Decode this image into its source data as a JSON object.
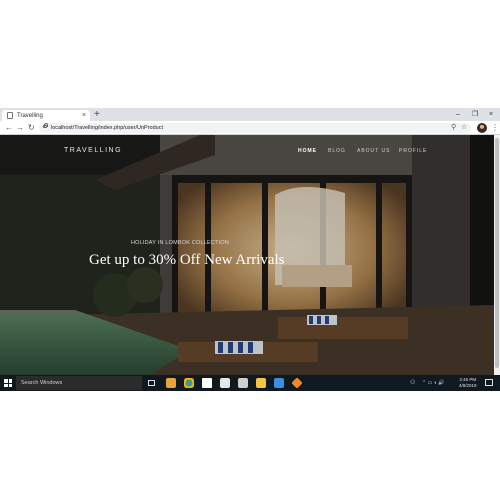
{
  "browser": {
    "tab_title": "Travelling",
    "tab_close": "×",
    "new_tab": "+",
    "minimize": "–",
    "restore": "❐",
    "close": "×",
    "back": "←",
    "forward": "→",
    "reload": "↻",
    "url": "localhost/Travelling/index.php/user/UnProduct",
    "zoom_icon": "⚲",
    "star_icon": "☆",
    "menu_dots": "⋮"
  },
  "site": {
    "brand": "TRAVELLING",
    "menu": [
      "HOME",
      "BLOG",
      "ABOUT US",
      "PROFILE"
    ],
    "active_menu": "HOME",
    "hero_subtitle": "HOLIDAY IN LOMBOK COLLECTION",
    "hero_title": "Get up to 30% Off New Arrivals"
  },
  "taskbar": {
    "search_placeholder": "Search Windows",
    "time": "2:46 PM",
    "date": "4/9/2019",
    "tray_icons": "⌃ ▭ ◖ 🔊"
  },
  "colors": {
    "page_bg": "#1e1d1b",
    "taskbar_bg": "#101820",
    "tab_strip": "#dee1e6"
  }
}
